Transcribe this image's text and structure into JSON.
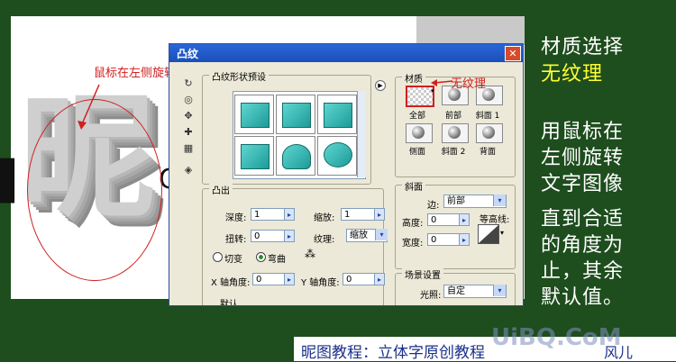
{
  "annotations": {
    "left_note": "鼠标在左侧旋转",
    "texture_note": "无纹理"
  },
  "canvas": {
    "big_char": "昵",
    "stray_left": "▌",
    "stray_right": "C"
  },
  "dialog": {
    "title": "凸纹",
    "close": "✕",
    "preset_group": "凸纹形状预设",
    "emboss_group": "凸出",
    "depth_label": "深度:",
    "depth_value": "1",
    "scale_label": "缩放:",
    "scale_value": "1",
    "twist_label": "扭转:",
    "twist_value": "0",
    "texture_label": "纹理:",
    "texture_value": "缩放",
    "radio_cut": "切变",
    "radio_bend": "弯曲",
    "x_angle_label": "X 轴角度:",
    "x_angle_value": "0",
    "y_angle_label": "Y 轴角度:",
    "y_angle_value": "0",
    "material_group": "材质",
    "materials": [
      "全部",
      "前部",
      "斜面 1",
      "侧面",
      "斜面 2",
      "背面"
    ],
    "bevel_group": "斜面",
    "edge_label": "边:",
    "edge_value": "前部",
    "height_label": "高度:",
    "height_value": "0",
    "contour_label": "等高线:",
    "width_label": "宽度:",
    "width_value": "0",
    "scene_group": "场景设置",
    "lighting_label": "光照:",
    "lighting_value": "自定",
    "cut_text": "默认"
  },
  "caption": {
    "line1": "材质选择",
    "line2": "无纹理",
    "lines": [
      "用鼠标在",
      "左侧旋转",
      "文字图像",
      "直到合适",
      "的角度为",
      "止，其余",
      "默认值。"
    ]
  },
  "footer": {
    "text": "昵图教程：立体字原创教程",
    "author": "风儿"
  },
  "watermark": "UiBQ.CoM",
  "colors": {
    "background": "#1e4d1e",
    "accent_red": "#d02020",
    "caption_yellow": "#ffff33",
    "footer_text": "#1a2f8a"
  }
}
